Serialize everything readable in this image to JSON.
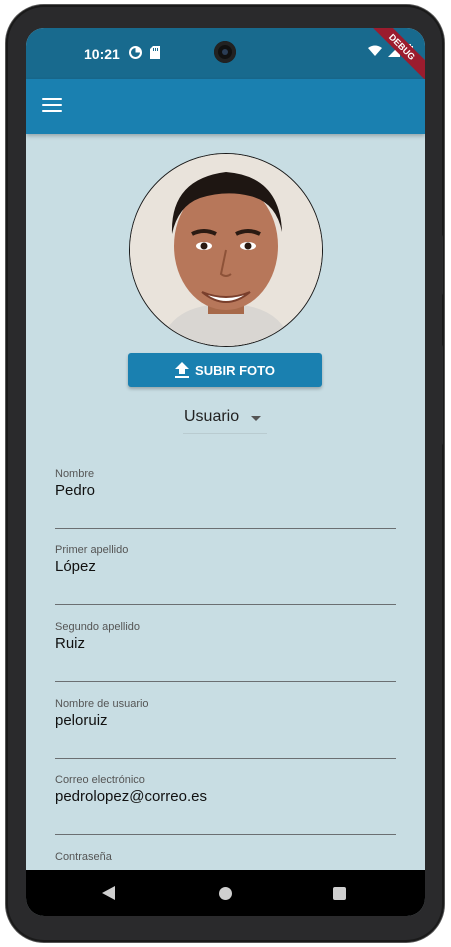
{
  "status": {
    "time": "10:21",
    "debug_banner": "DEBUG"
  },
  "upload_button": {
    "label": "SUBIR FOTO"
  },
  "role_select": {
    "value": "Usuario"
  },
  "fields": [
    {
      "label": "Nombre",
      "value": "Pedro"
    },
    {
      "label": "Primer apellido",
      "value": "López"
    },
    {
      "label": "Segundo apellido",
      "value": "Ruiz"
    },
    {
      "label": "Nombre de usuario",
      "value": "peloruiz"
    },
    {
      "label": "Correo electrónico",
      "value": "pedrolopez@correo.es"
    },
    {
      "label": "Contraseña",
      "value": ""
    }
  ],
  "icons": {
    "menu": "menu-icon",
    "upload": "upload-icon",
    "dropdown": "chevron-down-icon",
    "wifi": "wifi-icon",
    "signal": "signal-icon",
    "battery": "battery-icon"
  },
  "colors": {
    "status_bar": "#186a8e",
    "app_bar": "#1a80b0",
    "background": "#c8dde3",
    "button": "#1a80b0"
  }
}
